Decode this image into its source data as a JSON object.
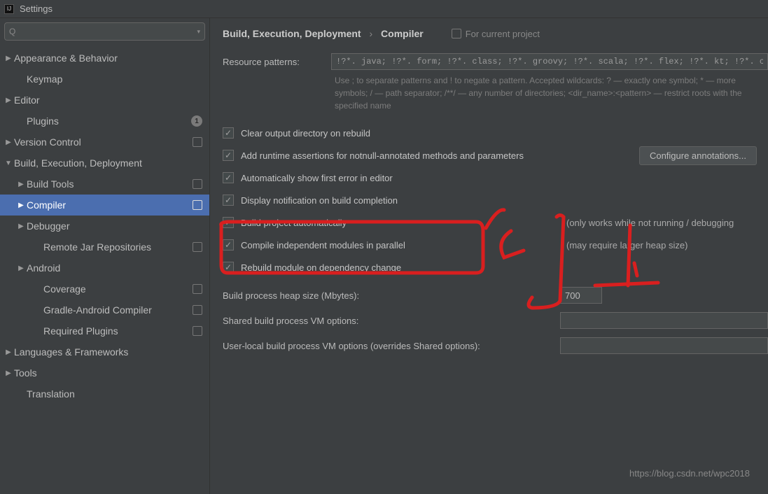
{
  "title": "Settings",
  "search": {
    "placeholder": ""
  },
  "sidebar": {
    "items": [
      {
        "label": "Appearance & Behavior",
        "depth": 0,
        "arrow": "▶",
        "proj": false
      },
      {
        "label": "Keymap",
        "depth": 1,
        "arrow": "",
        "proj": false
      },
      {
        "label": "Editor",
        "depth": 0,
        "arrow": "▶",
        "proj": false
      },
      {
        "label": "Plugins",
        "depth": 1,
        "arrow": "",
        "proj": false,
        "count": "1"
      },
      {
        "label": "Version Control",
        "depth": 0,
        "arrow": "▶",
        "proj": true
      },
      {
        "label": "Build, Execution, Deployment",
        "depth": 0,
        "arrow": "▼",
        "proj": false
      },
      {
        "label": "Build Tools",
        "depth": 1,
        "arrow": "▶",
        "proj": true
      },
      {
        "label": "Compiler",
        "depth": 1,
        "arrow": "▶",
        "proj": true,
        "selected": true
      },
      {
        "label": "Debugger",
        "depth": 1,
        "arrow": "▶",
        "proj": false
      },
      {
        "label": "Remote Jar Repositories",
        "depth": 2,
        "arrow": "",
        "proj": true
      },
      {
        "label": "Android",
        "depth": 1,
        "arrow": "▶",
        "proj": false
      },
      {
        "label": "Coverage",
        "depth": 2,
        "arrow": "",
        "proj": true
      },
      {
        "label": "Gradle-Android Compiler",
        "depth": 2,
        "arrow": "",
        "proj": true
      },
      {
        "label": "Required Plugins",
        "depth": 2,
        "arrow": "",
        "proj": true
      },
      {
        "label": "Languages & Frameworks",
        "depth": 0,
        "arrow": "▶",
        "proj": false
      },
      {
        "label": "Tools",
        "depth": 0,
        "arrow": "▶",
        "proj": false
      },
      {
        "label": "Translation",
        "depth": 1,
        "arrow": "",
        "proj": false
      }
    ]
  },
  "breadcrumb": {
    "parent": "Build, Execution, Deployment",
    "current": "Compiler"
  },
  "proj_hint": "For current project",
  "resource_patterns": {
    "label": "Resource patterns:",
    "value": "!?*. java; !?*. form; !?*. class; !?*. groovy; !?*. scala; !?*. flex; !?*. kt; !?*. clj; !?*."
  },
  "helptext": "Use ; to separate patterns and ! to negate a pattern. Accepted wildcards: ? — exactly one symbol; * — more symbols; / — path separator; /**/ — any number of directories; <dir_name>:<pattern> — restrict roots with the specified name",
  "checks": {
    "clear_output": "Clear output directory on rebuild",
    "add_runtime": "Add runtime assertions for notnull-annotated methods and parameters",
    "auto_first_error": "Automatically show first error in editor",
    "display_notification": "Display notification on build completion",
    "build_auto": "Build project automatically",
    "build_auto_note": "(only works while not running / debugging",
    "compile_parallel": "Compile independent modules in parallel",
    "compile_parallel_note": "(may require larger heap size)",
    "rebuild_dep": "Rebuild module on dependency change"
  },
  "configure_btn": "Configure annotations...",
  "fields": {
    "heap_label": "Build process heap size (Mbytes):",
    "heap_value": "700",
    "shared_vm": "Shared build process VM options:",
    "user_vm": "User-local build process VM options (overrides Shared options):"
  },
  "watermark": "https://blog.csdn.net/wpc2018"
}
